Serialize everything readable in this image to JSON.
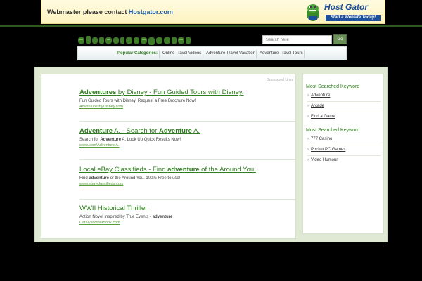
{
  "banner": {
    "message": "Webmaster please contact",
    "host_link": "Hostgator.com",
    "logo_name": "Host Gator",
    "logo_tagline": "Start a Website Today!"
  },
  "search": {
    "placeholder": "Search here",
    "button_label": "Go"
  },
  "categories": {
    "label": "Popular Categories:",
    "items": [
      "Online Travel Videos",
      "Adventure Travel Vacation",
      "Adventure Travel Tours"
    ]
  },
  "ads": {
    "sponsored_label": "Sponsored Links",
    "items": [
      {
        "title_pre": "",
        "title_bold": "Adventures",
        "title_post": " by Disney - Fun Guided Tours with Disney.",
        "desc_pre": "Fun Guided Tours with Disney. Request a Free Brochure Now!",
        "desc_bold": "",
        "desc_post": "",
        "url": "AdventuresbyDisney.com"
      },
      {
        "title_pre": "",
        "title_bold": "Adventure",
        "title_post": " A. - Search for ",
        "title_bold2": "Adventure",
        "title_post2": " A.",
        "desc_pre": "Search for ",
        "desc_bold": "Adventure",
        "desc_post": " A. Look Up Quick Results Now!",
        "url": "www.com/Adventure A."
      },
      {
        "title_pre": "Local eBay Classifieds - Find ",
        "title_bold": "adventure",
        "title_post": " of the Around You.",
        "desc_pre": "Find ",
        "desc_bold": "adventure",
        "desc_post": " of the Around You. 100% Free to use!",
        "url": "www.ebayclassifieds.com"
      },
      {
        "title_pre": "WWII Historical Thriller",
        "title_bold": "",
        "title_post": "",
        "desc_pre": "Action Novel Inspired by True Events - ",
        "desc_bold": "adventure",
        "desc_post": "",
        "url": "CatalystWWIIBook.com"
      }
    ]
  },
  "sidebar": {
    "sections": [
      {
        "heading": "Most Searched Keyword",
        "items": [
          "Adventure",
          "Arcade",
          "Find a Game"
        ]
      },
      {
        "heading": "Most Searched Keyword",
        "items": [
          "777 Casino",
          "Pocket PC Games",
          "Video Humour"
        ]
      }
    ]
  },
  "colors": {
    "accent_green": "#2e7d1e",
    "banner_bg": "#fdf4c0",
    "host_blue": "#1c4f9c"
  }
}
